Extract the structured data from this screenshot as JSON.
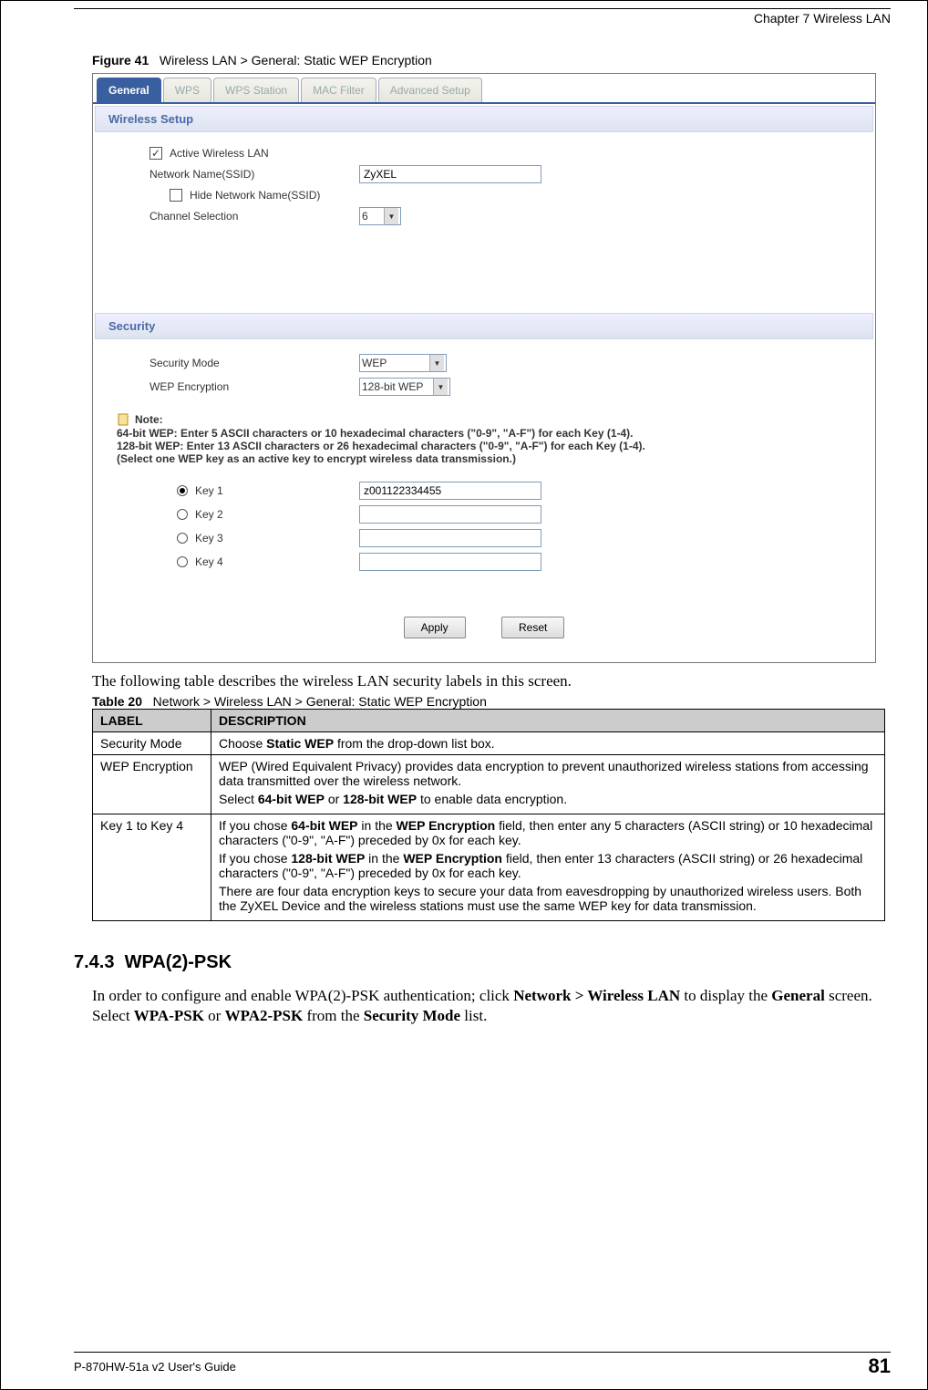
{
  "page": {
    "chapter": "Chapter 7 Wireless LAN",
    "guide": "P-870HW-51a v2 User's Guide",
    "page_number": "81"
  },
  "figure": {
    "label": "Figure 41",
    "caption": "Wireless LAN > General: Static WEP Encryption"
  },
  "screenshot": {
    "tabs": [
      "General",
      "WPS",
      "WPS Station",
      "MAC Filter",
      "Advanced Setup"
    ],
    "active_tab": "General",
    "wireless_setup": {
      "title": "Wireless Setup",
      "active_wireless_label": "Active Wireless LAN",
      "active_wireless_checked": true,
      "ssid_label": "Network Name(SSID)",
      "ssid_value": "ZyXEL",
      "hide_ssid_label": "Hide Network Name(SSID)",
      "hide_ssid_checked": false,
      "channel_label": "Channel Selection",
      "channel_value": "6"
    },
    "security": {
      "title": "Security",
      "mode_label": "Security Mode",
      "mode_value": "WEP",
      "wep_enc_label": "WEP Encryption",
      "wep_enc_value": "128-bit WEP",
      "note_label": "Note:",
      "note_line1": "64-bit WEP: Enter 5 ASCII characters or 10 hexadecimal characters (\"0-9\", \"A-F\") for each Key (1-4).",
      "note_line2": "128-bit WEP: Enter 13 ASCII characters or 26 hexadecimal characters (\"0-9\", \"A-F\") for each Key (1-4).",
      "note_line3": "(Select one WEP key as an active key to encrypt wireless data transmission.)",
      "keys": [
        {
          "label": "Key 1",
          "value": "z001122334455",
          "selected": true
        },
        {
          "label": "Key 2",
          "value": "",
          "selected": false
        },
        {
          "label": "Key 3",
          "value": "",
          "selected": false
        },
        {
          "label": "Key 4",
          "value": "",
          "selected": false
        }
      ],
      "apply_label": "Apply",
      "reset_label": "Reset"
    }
  },
  "post_figure_text": "The following table describes the wireless LAN security labels in this screen.",
  "table": {
    "caption_label": "Table 20",
    "caption": "Network > Wireless LAN > General: Static WEP Encryption",
    "header": {
      "label": "LABEL",
      "description": "DESCRIPTION"
    },
    "rows": [
      {
        "label": "Security Mode",
        "description_pre": "Choose ",
        "description_bold": "Static WEP",
        "description_post": " from the drop-down list box."
      },
      {
        "label": "WEP Encryption",
        "para1": "WEP (Wired Equivalent Privacy) provides data encryption to prevent unauthorized wireless stations from accessing data transmitted over the wireless network.",
        "para2_pre": "Select ",
        "para2_b1": "64-bit WEP",
        "para2_mid": " or ",
        "para2_b2": "128-bit WEP",
        "para2_post": " to enable data encryption."
      },
      {
        "label": "Key 1 to Key 4",
        "p1a": "If you chose ",
        "p1b1": "64-bit WEP",
        "p1b": " in the ",
        "p1b2": "WEP Encryption",
        "p1c": " field, then enter any 5 characters (ASCII string) or 10 hexadecimal characters (\"0-9\", \"A-F\") preceded by 0x for each key.",
        "p2a": "If you chose ",
        "p2b1": "128-bit WEP",
        "p2b": " in the ",
        "p2b2": "WEP Encryption",
        "p2c": " field, then enter 13 characters (ASCII string) or 26 hexadecimal characters (\"0-9\", \"A-F\") preceded by 0x for each key.",
        "p3": "There are four data encryption keys to secure your data from eavesdropping by unauthorized wireless users. Both the ZyXEL Device and the wireless stations must use the same WEP key for data transmission."
      }
    ]
  },
  "subsection": {
    "number": "7.4.3",
    "title": "WPA(2)-PSK",
    "body_pre": "In order to configure and enable WPA(2)-PSK authentication; click ",
    "body_b1": "Network > Wireless LAN",
    "body_mid1": " to display the ",
    "body_b2": "General",
    "body_mid2": " screen. Select ",
    "body_b3": "WPA-PSK",
    "body_mid3": " or ",
    "body_b4": "WPA2-PSK",
    "body_mid4": " from the ",
    "body_b5": "Security Mode",
    "body_post": " list."
  }
}
